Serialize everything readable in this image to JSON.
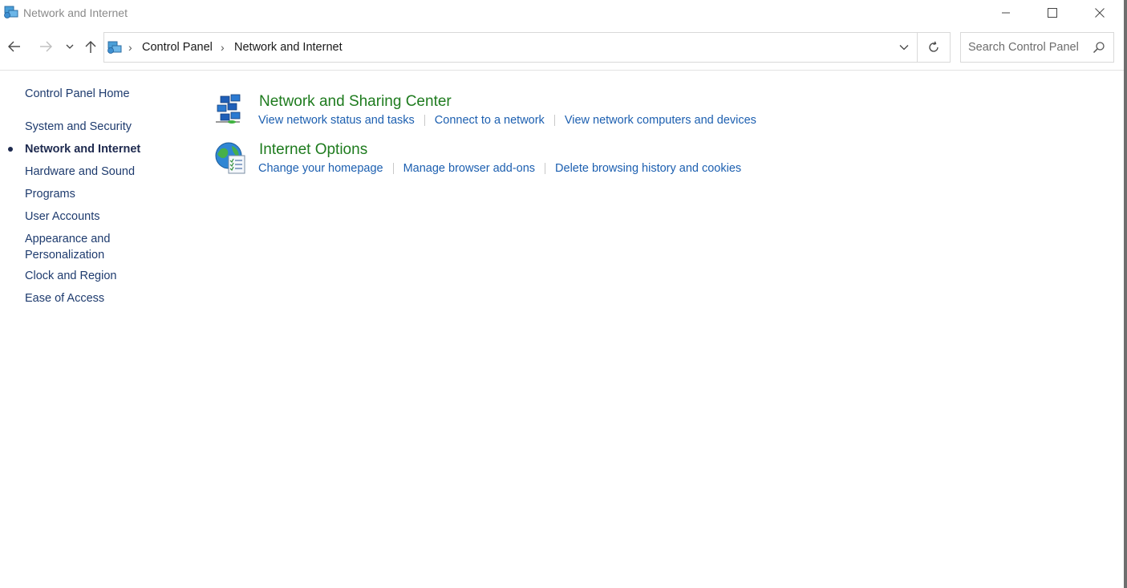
{
  "window": {
    "title": "Network and Internet",
    "app_icon": "network-internet-icon"
  },
  "address": {
    "crumbs": [
      "Control Panel",
      "Network and Internet"
    ],
    "location_icon": "network-internet-icon"
  },
  "search": {
    "placeholder": "Search Control Panel",
    "value": ""
  },
  "sidebar": {
    "home": "Control Panel Home",
    "items": [
      {
        "label": "System and Security",
        "active": false
      },
      {
        "label": "Network and Internet",
        "active": true
      },
      {
        "label": "Hardware and Sound",
        "active": false
      },
      {
        "label": "Programs",
        "active": false
      },
      {
        "label": "User Accounts",
        "active": false
      },
      {
        "label": "Appearance and\nPersonalization",
        "active": false
      },
      {
        "label": "Clock and Region",
        "active": false
      },
      {
        "label": "Ease of Access",
        "active": false
      }
    ]
  },
  "main": {
    "categories": [
      {
        "title": "Network and Sharing Center",
        "icon": "network-sharing-center-icon",
        "links": [
          "View network status and tasks",
          "Connect to a network",
          "View network computers and devices"
        ]
      },
      {
        "title": "Internet Options",
        "icon": "internet-options-icon",
        "links": [
          "Change your homepage",
          "Manage browser add-ons",
          "Delete browsing history and cookies"
        ]
      }
    ]
  },
  "colors": {
    "category_title": "#1e7b1e",
    "link": "#1c5fb0",
    "nav_text": "#1e3b6e"
  }
}
